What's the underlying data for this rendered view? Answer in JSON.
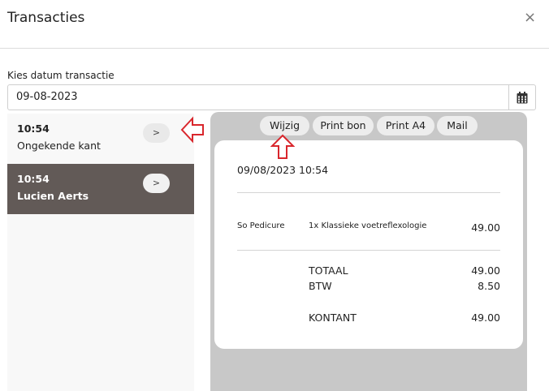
{
  "dialog": {
    "title": "Transacties",
    "close_glyph": "×"
  },
  "date_picker": {
    "label": "Kies datum transactie",
    "value": "09-08-2023",
    "icon": "calendar-icon"
  },
  "transactions": [
    {
      "time": "10:54",
      "name": "Ongekende kant",
      "go_label": ">",
      "selected": false
    },
    {
      "time": "10:54",
      "name": "Lucien Aerts",
      "go_label": ">",
      "selected": true
    }
  ],
  "actions": {
    "wijzig": "Wijzig",
    "print_bon": "Print bon",
    "print_a4": "Print A4",
    "mail": "Mail"
  },
  "receipt": {
    "datetime": "09/08/2023 10:54",
    "line_items": [
      {
        "category": "So Pedicure",
        "description": "1x Klassieke voetreflexologie",
        "amount": "49.00"
      }
    ],
    "totals": [
      {
        "label": "TOTAAL",
        "amount": "49.00"
      },
      {
        "label": "BTW",
        "amount": "8.50"
      }
    ],
    "payment": {
      "label": "KONTANT",
      "amount": "49.00"
    }
  },
  "colors": {
    "selected_row": "#625a57",
    "panel_gray": "#c8c8c8",
    "annotation_arrow": "#d9262c"
  }
}
